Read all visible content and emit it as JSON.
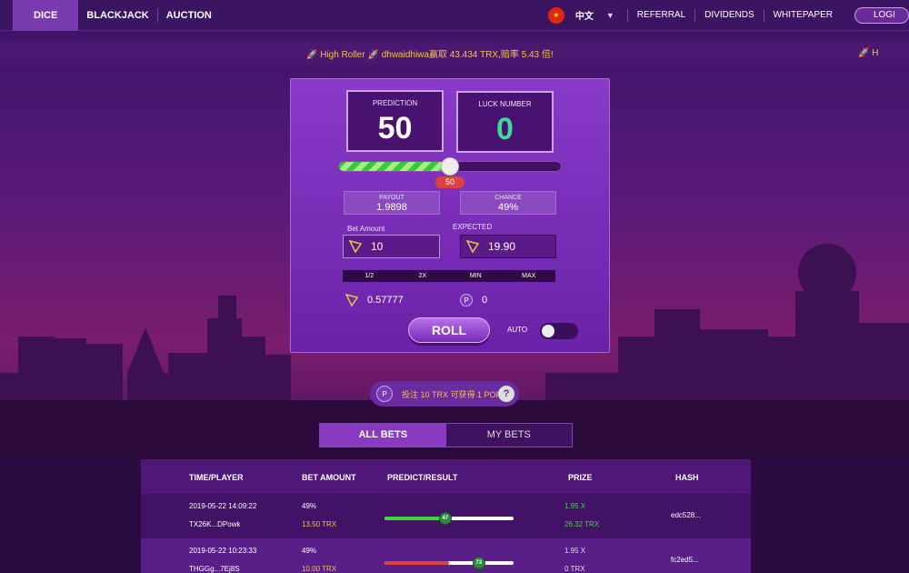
{
  "nav": {
    "tabs": [
      "DICE",
      "BLACKJACK",
      "AUCTION"
    ],
    "language": "中文",
    "links": [
      "REFERRAL",
      "DIVIDENDS",
      "WHITEPAPER"
    ],
    "login": "LOGI"
  },
  "ticker": {
    "message": "🚀 High Roller 🚀 dhwaidhiwa赢取 43.434 TRX,赔率 5.43 倍!",
    "trailing": "🚀 H"
  },
  "game": {
    "prediction_label": "PREDICTION",
    "prediction_value": "50",
    "luck_label": "LUCK NUMBER",
    "luck_value": "0",
    "slider_value": 50,
    "slider_bubble": "50",
    "payout_label": "PAYOUT",
    "payout_value": "1.9898",
    "chance_label": "CHANCE",
    "chance_value": "49%",
    "bet_label": "Bet Amount",
    "bet_value": "10",
    "expected_label": "EXPECTED",
    "expected_value": "19.90",
    "quick": [
      "1/2",
      "2X",
      "MIN",
      "MAX"
    ],
    "trx_balance": "0.57777",
    "pop_balance": "0",
    "roll_label": "ROLL",
    "auto_label": "AUTO"
  },
  "promo": {
    "text": "投注 10 TRX 可获得 1 POP",
    "help": "?"
  },
  "bet_tabs": [
    "ALL BETS",
    "MY BETS"
  ],
  "table": {
    "headers": [
      "TIME/PLAYER",
      "BET AMOUNT",
      "PREDICT/RESULT",
      "PRIZE",
      "HASH"
    ],
    "rows": [
      {
        "time": "2019-05-22 14:09:22",
        "player": "TX26K...DPowk",
        "pct": "49%",
        "amount": "13.50 TRX",
        "predict": 50,
        "result": "47",
        "result_num": 47,
        "win": true,
        "mult": "1.95 X",
        "prize": "26.32 TRX",
        "hash": "edc528..."
      },
      {
        "time": "2019-05-22 10:23:33",
        "player": "THGGg...7Ej8S",
        "pct": "49%",
        "amount": "10.00 TRX",
        "predict": 50,
        "result": "73",
        "result_num": 73,
        "win": false,
        "mult": "1.95 X",
        "prize": "0 TRX",
        "hash": "fc2ed5..."
      }
    ]
  },
  "colors": {
    "accent": "#8a3ac0",
    "win": "#3ed83e",
    "lose": "#e04040",
    "gold": "#f3c43a",
    "luck": "#3ed89a"
  }
}
